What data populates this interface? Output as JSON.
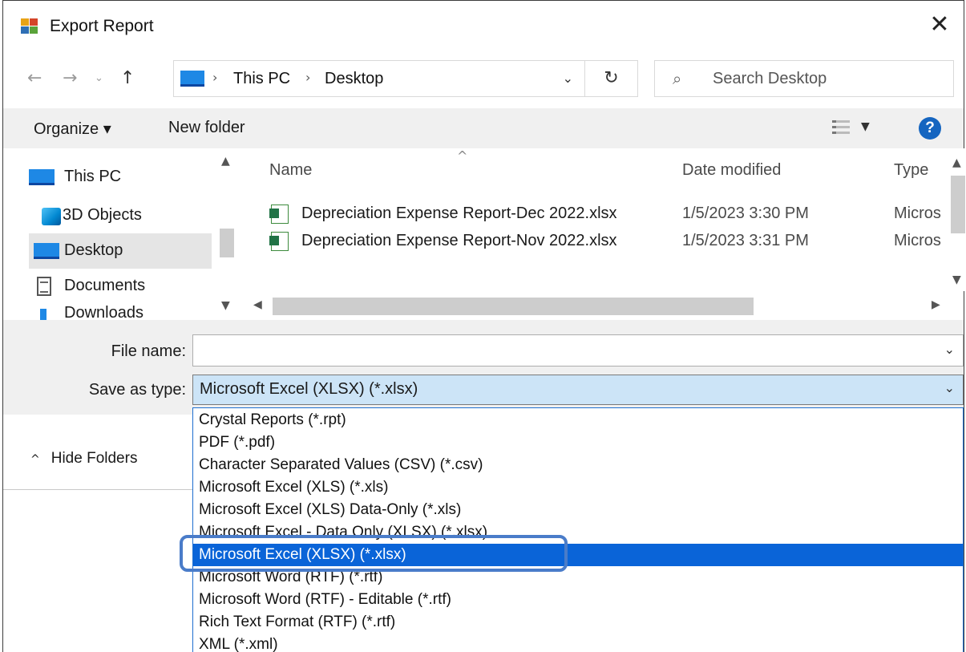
{
  "window": {
    "title": "Export Report"
  },
  "address": {
    "crumbs": [
      "This PC",
      "Desktop"
    ],
    "search_placeholder": "Search Desktop"
  },
  "commands": {
    "organize": "Organize ▾",
    "new_folder": "New folder"
  },
  "nav": {
    "items": [
      {
        "label": "This PC",
        "icon": "computer-icon"
      },
      {
        "label": "3D Objects",
        "icon": "3d-objects-icon"
      },
      {
        "label": "Desktop",
        "icon": "desktop-icon",
        "selected": true
      },
      {
        "label": "Documents",
        "icon": "documents-icon"
      },
      {
        "label": "Downloads",
        "icon": "downloads-icon"
      }
    ]
  },
  "file_list": {
    "columns": {
      "name": "Name",
      "date": "Date modified",
      "type": "Type"
    },
    "rows": [
      {
        "name": "Depreciation Expense Report-Dec 2022.xlsx",
        "date": "1/5/2023 3:30 PM",
        "type": "Micros"
      },
      {
        "name": "Depreciation Expense Report-Nov 2022.xlsx",
        "date": "1/5/2023 3:31 PM",
        "type": "Micros"
      }
    ]
  },
  "form": {
    "file_name_label": "File name:",
    "file_name_value": "",
    "save_as_type_label": "Save as type:",
    "save_as_type_value": "Microsoft Excel (XLSX) (*.xlsx)"
  },
  "hide_folders": "Hide Folders",
  "type_options": [
    "Crystal Reports (*.rpt)",
    "PDF (*.pdf)",
    "Character Separated Values (CSV) (*.csv)",
    "Microsoft Excel (XLS) (*.xls)",
    "Microsoft Excel (XLS) Data-Only (*.xls)",
    "Microsoft Excel - Data Only (XLSX) (*.xlsx)",
    "Microsoft Excel (XLSX) (*.xlsx)",
    "Microsoft Word (RTF) (*.rtf)",
    "Microsoft Word (RTF) - Editable (*.rtf)",
    "Rich Text Format (RTF) (*.rtf)",
    "XML (*.xml)"
  ],
  "selected_option_index": 6,
  "colors": {
    "selection": "#0a64d8",
    "highlight_ring": "#4a7cc9",
    "select_bg": "#cce4f7"
  }
}
